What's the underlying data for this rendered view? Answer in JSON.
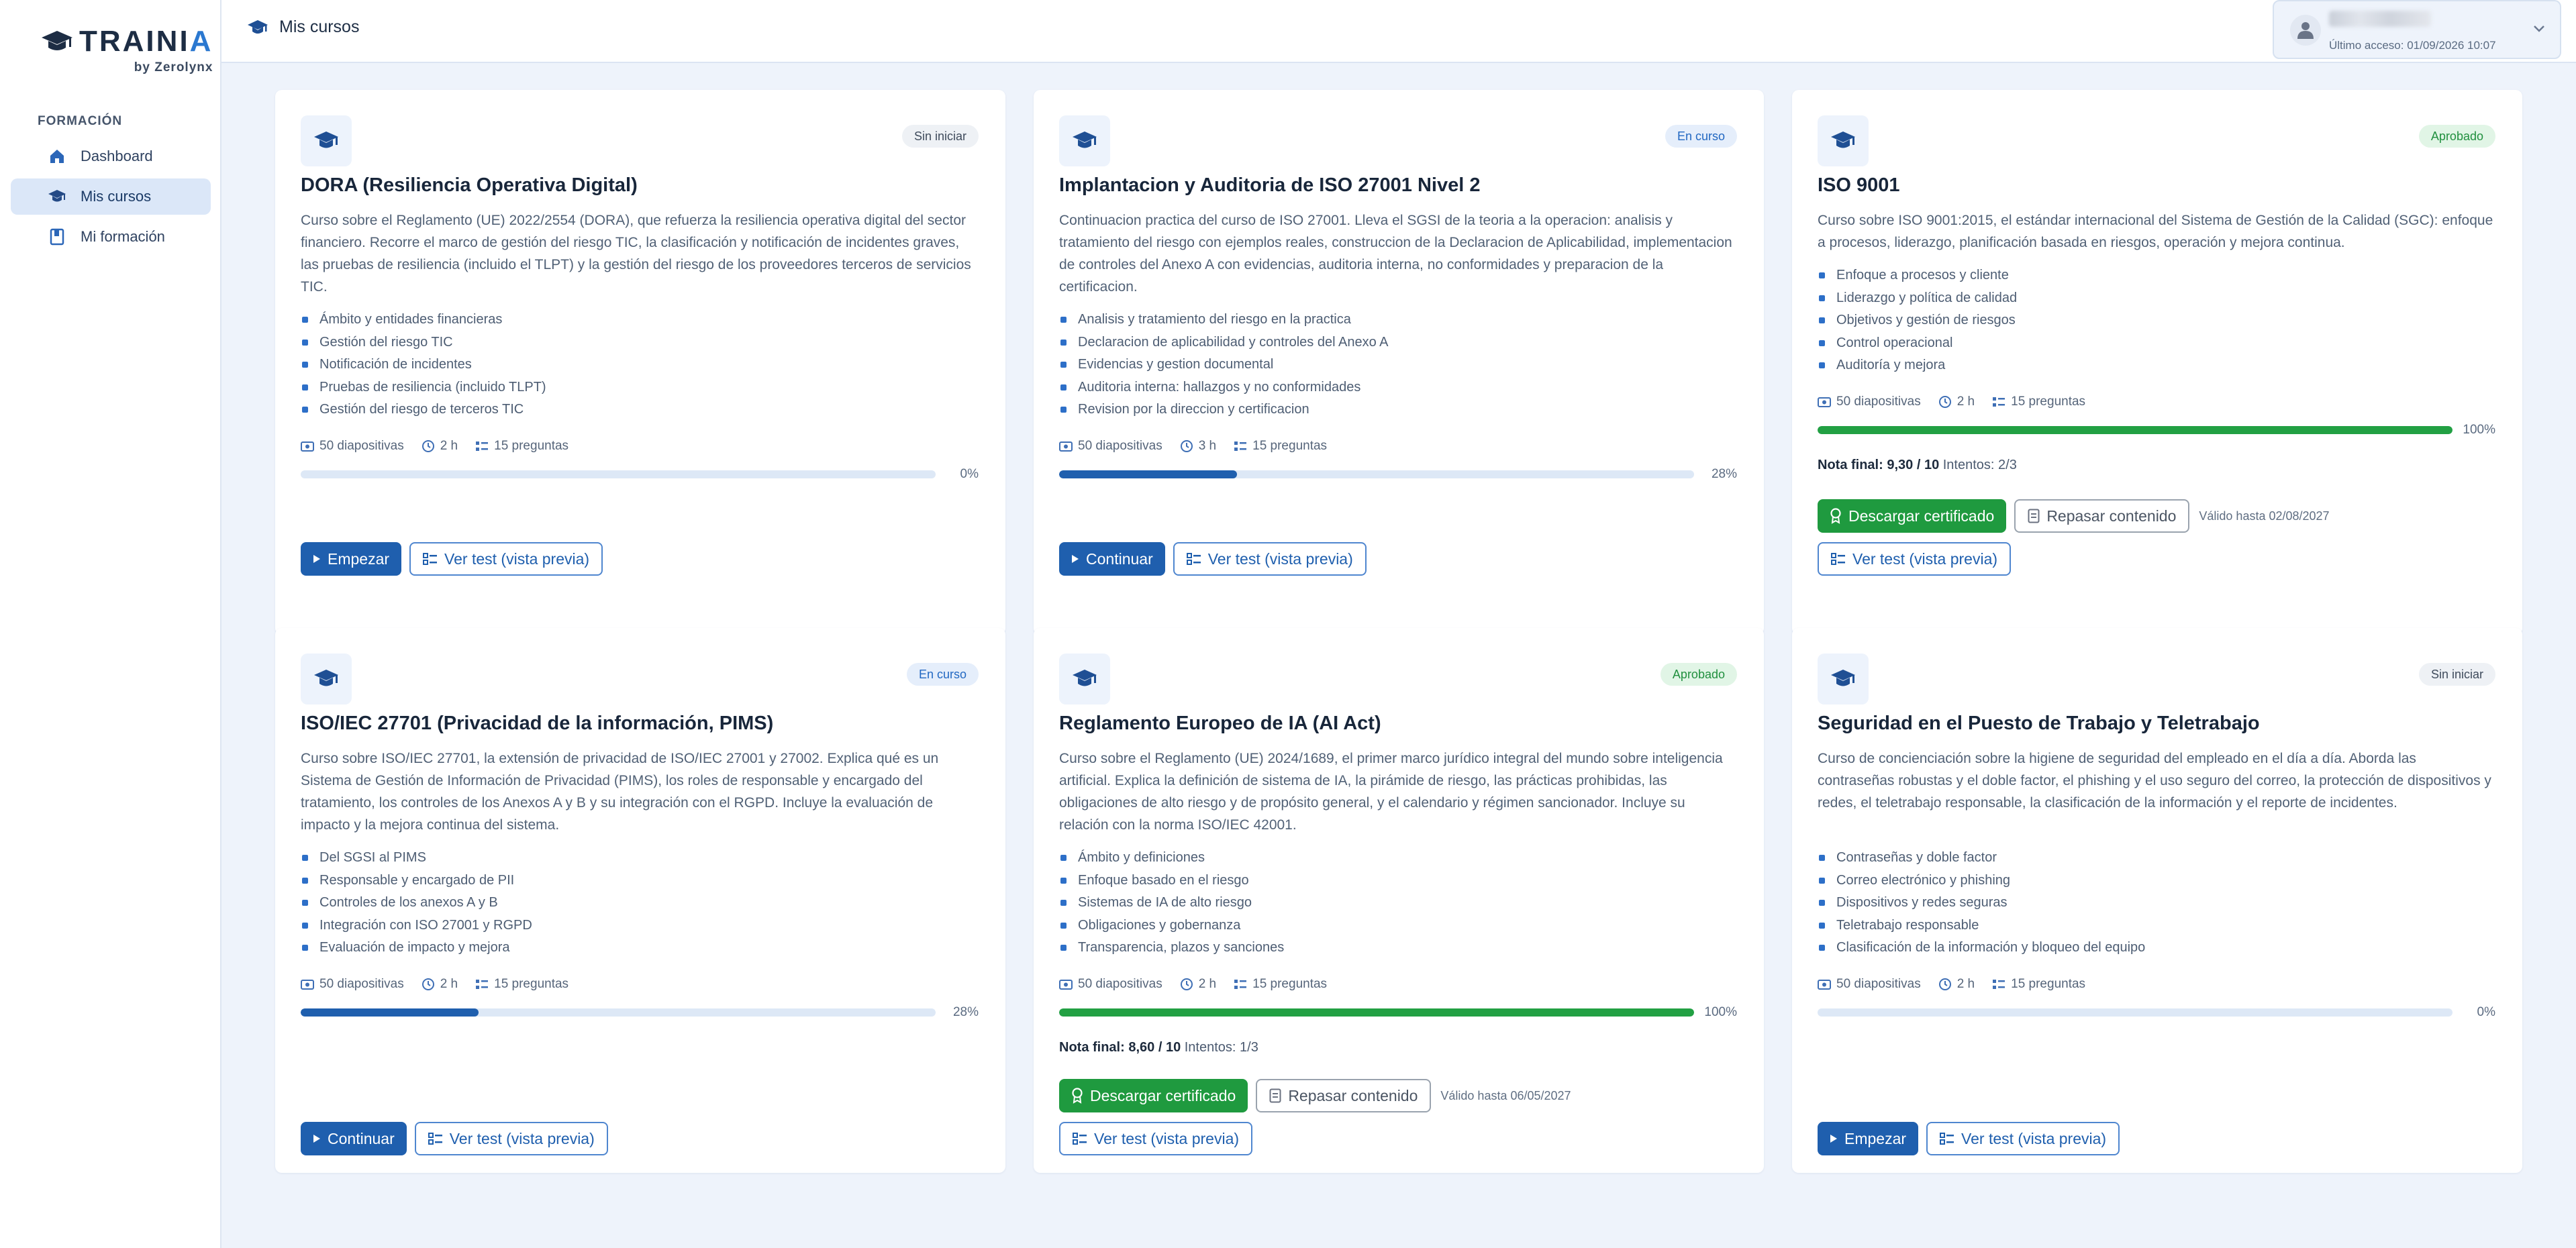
{
  "brand": {
    "name_part1": "TRAIN",
    "name_part2": "I",
    "name_part3": "A",
    "byline": "by Zerolynx"
  },
  "sidebar": {
    "section_label": "FORMACIÓN",
    "items": [
      {
        "label": "Dashboard",
        "icon": "home-icon"
      },
      {
        "label": "Mis cursos",
        "icon": "graduation-cap-icon",
        "active": true
      },
      {
        "label": "Mi formación",
        "icon": "book-icon"
      }
    ]
  },
  "header": {
    "title": "Mis cursos",
    "user": {
      "last_access": "Último acceso: 01/09/2026 10:07"
    }
  },
  "colors": {
    "primary": "#1f5fae",
    "success": "#1f9a3f",
    "background": "#eef3fb"
  },
  "courses": [
    {
      "status": "Sin iniciar",
      "title": "DORA (Resiliencia Operativa Digital)",
      "description": "Curso sobre el Reglamento (UE) 2022/2554 (DORA), que refuerza la resiliencia operativa digital del sector financiero. Recorre el marco de gestión del riesgo TIC, la clasificación y notificación de incidentes graves, las pruebas de resiliencia (incluido el TLPT) y la gestión del riesgo de los proveedores terceros de servicios TIC.",
      "topics": [
        "Ámbito y entidades financieras",
        "Gestión del riesgo TIC",
        "Notificación de incidentes",
        "Pruebas de resiliencia (incluido TLPT)",
        "Gestión del riesgo de terceros TIC"
      ],
      "slides": "50 diapositivas",
      "duration": "2 h",
      "questions": "15 preguntas",
      "progress": 0,
      "progress_label": "0%",
      "primary_action": "Empezar",
      "preview_action": "Ver test (vista previa)"
    },
    {
      "status": "En curso",
      "title": "Implantacion y Auditoria de ISO 27001 Nivel 2",
      "description": "Continuacion practica del curso de ISO 27001. Lleva el SGSI de la teoria a la operacion: analisis y tratamiento del riesgo con ejemplos reales, construccion de la Declaracion de Aplicabilidad, implementacion de controles del Anexo A con evidencias, auditoria interna, no conformidades y preparacion de la certificacion.",
      "topics": [
        "Analisis y tratamiento del riesgo en la practica",
        "Declaracion de aplicabilidad y controles del Anexo A",
        "Evidencias y gestion documental",
        "Auditoria interna: hallazgos y no conformidades",
        "Revision por la direccion y certificacion"
      ],
      "slides": "50 diapositivas",
      "duration": "3 h",
      "questions": "15 preguntas",
      "progress": 28,
      "progress_label": "28%",
      "primary_action": "Continuar",
      "preview_action": "Ver test (vista previa)"
    },
    {
      "status": "Aprobado",
      "title": "ISO 9001",
      "description": "Curso sobre ISO 9001:2015, el estándar internacional del Sistema de Gestión de la Calidad (SGC): enfoque a procesos, liderazgo, planificación basada en riesgos, operación y mejora continua.",
      "topics": [
        "Enfoque a procesos y cliente",
        "Liderazgo y política de calidad",
        "Objetivos y gestión de riesgos",
        "Control operacional",
        "Auditoría y mejora"
      ],
      "slides": "50 diapositivas",
      "duration": "2 h",
      "questions": "15 preguntas",
      "progress": 100,
      "progress_label": "100%",
      "grade_label": "Nota final:",
      "grade_value": "9,30 / 10",
      "attempts": "Intentos: 2/3",
      "certificate_action": "Descargar certificado",
      "review_action": "Repasar contenido",
      "valid_until": "Válido hasta 02/08/2027",
      "preview_action": "Ver test (vista previa)"
    },
    {
      "status": "En curso",
      "title": "ISO/IEC 27701 (Privacidad de la información, PIMS)",
      "description": "Curso sobre ISO/IEC 27701, la extensión de privacidad de ISO/IEC 27001 y 27002. Explica qué es un Sistema de Gestión de Información de Privacidad (PIMS), los roles de responsable y encargado del tratamiento, los controles de los Anexos A y B y su integración con el RGPD. Incluye la evaluación de impacto y la mejora continua del sistema.",
      "topics": [
        "Del SGSI al PIMS",
        "Responsable y encargado de PII",
        "Controles de los anexos A y B",
        "Integración con ISO 27001 y RGPD",
        "Evaluación de impacto y mejora"
      ],
      "slides": "50 diapositivas",
      "duration": "2 h",
      "questions": "15 preguntas",
      "progress": 28,
      "progress_label": "28%",
      "primary_action": "Continuar",
      "preview_action": "Ver test (vista previa)"
    },
    {
      "status": "Aprobado",
      "title": "Reglamento Europeo de IA (AI Act)",
      "description": "Curso sobre el Reglamento (UE) 2024/1689, el primer marco jurídico integral del mundo sobre inteligencia artificial. Explica la definición de sistema de IA, la pirámide de riesgo, las prácticas prohibidas, las obligaciones de alto riesgo y de propósito general, y el calendario y régimen sancionador. Incluye su relación con la norma ISO/IEC 42001.",
      "topics": [
        "Ámbito y definiciones",
        "Enfoque basado en el riesgo",
        "Sistemas de IA de alto riesgo",
        "Obligaciones y gobernanza",
        "Transparencia, plazos y sanciones"
      ],
      "slides": "50 diapositivas",
      "duration": "2 h",
      "questions": "15 preguntas",
      "progress": 100,
      "progress_label": "100%",
      "grade_label": "Nota final:",
      "grade_value": "8,60 / 10",
      "attempts": "Intentos: 1/3",
      "certificate_action": "Descargar certificado",
      "review_action": "Repasar contenido",
      "valid_until": "Válido hasta 06/05/2027",
      "preview_action": "Ver test (vista previa)"
    },
    {
      "status": "Sin iniciar",
      "title": "Seguridad en el Puesto de Trabajo y Teletrabajo",
      "description": "Curso de concienciación sobre la higiene de seguridad del empleado en el día a día. Aborda las contraseñas robustas y el doble factor, el phishing y el uso seguro del correo, la protección de dispositivos y redes, el teletrabajo responsable, la clasificación de la información y el reporte de incidentes.",
      "topics": [
        "Contraseñas y doble factor",
        "Correo electrónico y phishing",
        "Dispositivos y redes seguras",
        "Teletrabajo responsable",
        "Clasificación de la información y bloqueo del equipo"
      ],
      "slides": "50 diapositivas",
      "duration": "2 h",
      "questions": "15 preguntas",
      "progress": 0,
      "progress_label": "0%",
      "primary_action": "Empezar",
      "preview_action": "Ver test (vista previa)"
    }
  ]
}
